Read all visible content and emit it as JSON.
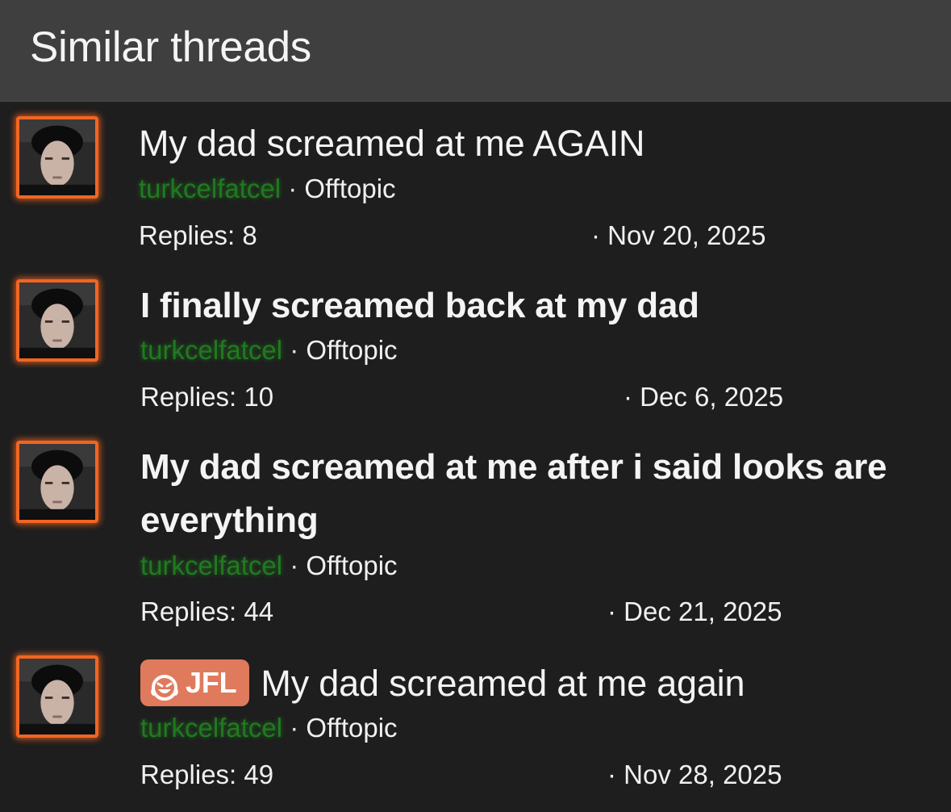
{
  "header": {
    "title": "Similar threads"
  },
  "threads": [
    {
      "title": "My dad screamed at me AGAIN",
      "author": "turkcelfatcel",
      "forum": "Offtopic",
      "replies": "Replies: 8",
      "date": "Nov 20, 2025",
      "bold": false
    },
    {
      "title": "I finally screamed back at my dad",
      "author": "turkcelfatcel",
      "forum": "Offtopic",
      "replies": "Replies: 10",
      "date": "Dec 6, 2025",
      "bold": true
    },
    {
      "title": "My dad screamed at me after i said looks are everything",
      "author": "turkcelfatcel",
      "forum": "Offtopic",
      "replies": "Replies: 44",
      "date": "Dec 21, 2025",
      "bold": true
    },
    {
      "prefix": "JFL",
      "prefix_icon": "laughing-emoji-icon",
      "title": "My dad screamed at me again",
      "author": "turkcelfatcel",
      "forum": "Offtopic",
      "replies": "Replies: 49",
      "date": "Nov 28, 2025",
      "bold": false
    }
  ],
  "separator": "·",
  "colors": {
    "header_bg": "#3f3f3f",
    "page_bg": "#1e1e1e",
    "avatar_border": "#f26522",
    "author": "#1f7a1f",
    "prefix_badge": "#e07a5c"
  }
}
